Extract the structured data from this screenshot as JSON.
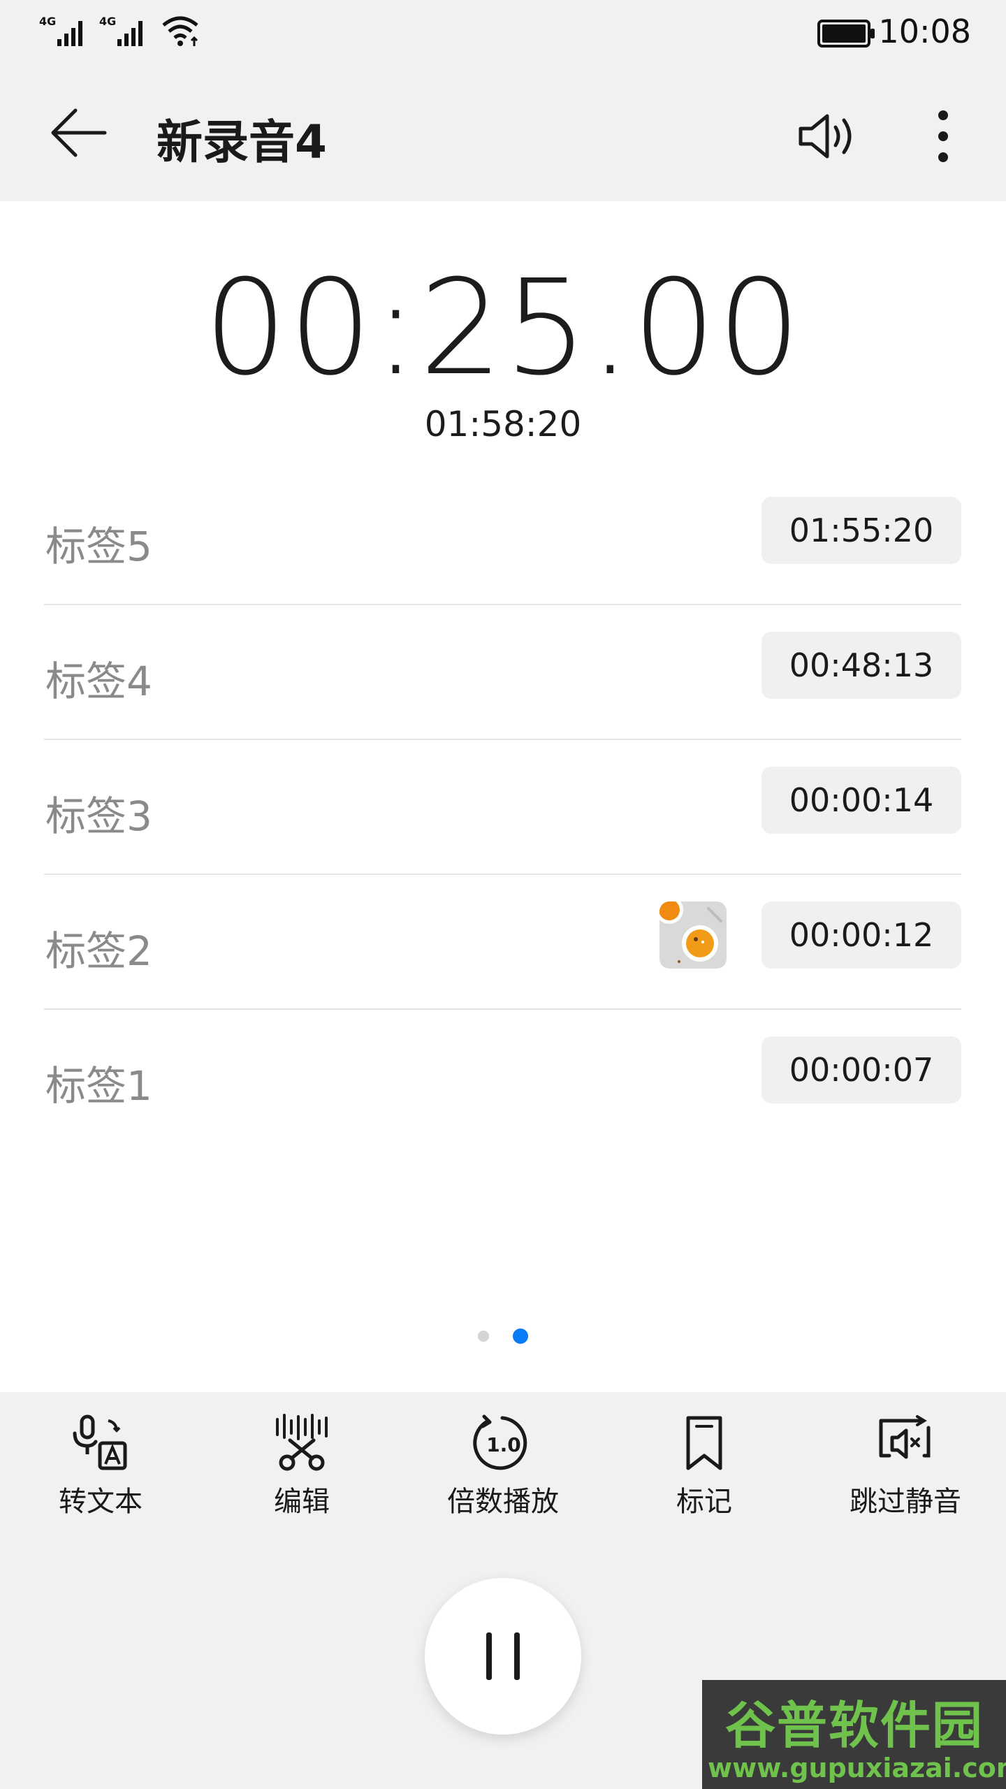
{
  "status_bar": {
    "signal1_label": "4G",
    "signal2_label": "4G",
    "time": "10:08"
  },
  "app_bar": {
    "title": "新录音4",
    "icons": [
      "back-arrow-icon",
      "speaker-icon",
      "more-vert-icon"
    ]
  },
  "player": {
    "current_time": "00:25.00",
    "total_time": "01:58:20"
  },
  "tags": [
    {
      "label": "标签5",
      "time": "01:55:20",
      "has_image": false
    },
    {
      "label": "标签4",
      "time": "00:48:13",
      "has_image": false
    },
    {
      "label": "标签3",
      "time": "00:00:14",
      "has_image": false
    },
    {
      "label": "标签2",
      "time": "00:00:12",
      "has_image": true
    },
    {
      "label": "标签1",
      "time": "00:00:07",
      "has_image": false
    }
  ],
  "pager": {
    "count": 2,
    "active_index": 1
  },
  "toolbar": {
    "to_text": "转文本",
    "edit": "编辑",
    "speed": "倍数播放",
    "speed_value": "1.0",
    "mark": "标记",
    "skip_silence": "跳过静音"
  },
  "colors": {
    "accent": "#0a7cf5",
    "background": "#f1f1f1",
    "surface": "#ffffff",
    "tag_label": "#8a8a8a",
    "time_chip": "#f0f0f0"
  },
  "watermark": {
    "title": "谷普软件园",
    "url": "www.gupuxiazai.com"
  }
}
